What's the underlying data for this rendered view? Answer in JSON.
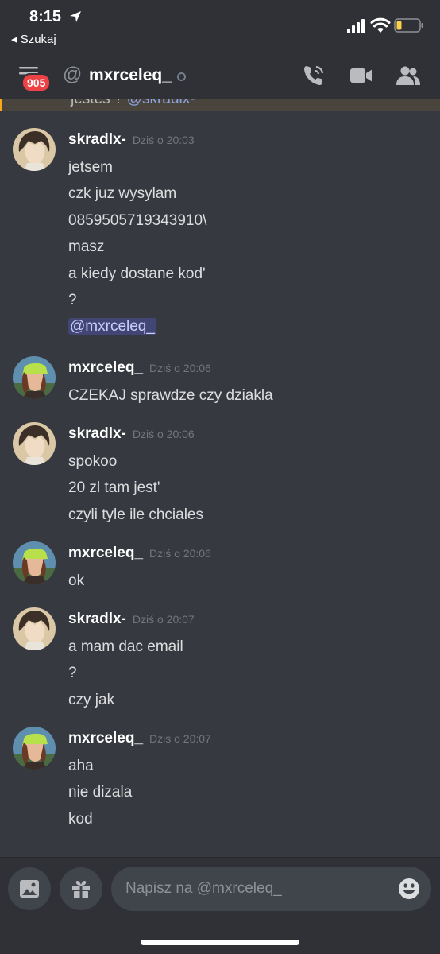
{
  "status_bar": {
    "time": "8:15",
    "back_label": "◂ Szukaj"
  },
  "header": {
    "unread_badge": "905",
    "channel_name": "mxrceleq_"
  },
  "reply_preview": {
    "text": "jesteś ? ",
    "mention": "@skradlx-"
  },
  "messages": [
    {
      "author": "skradlx-",
      "timestamp": "Dziś o 20:03",
      "lines": [
        "jetsem",
        "czk juz wysylam",
        "0859505719343910\\",
        "masz",
        "a kiedy dostane kod'",
        "?"
      ],
      "mention": "@mxrceleq_"
    },
    {
      "author": "mxrceleq_",
      "timestamp": "Dziś o 20:06",
      "lines": [
        "CZEKAJ sprawdze czy dziakla"
      ]
    },
    {
      "author": "skradlx-",
      "timestamp": "Dziś o 20:06",
      "lines": [
        "spokoo",
        "20 zl tam jest'",
        "czyli tyle ile chciales"
      ]
    },
    {
      "author": "mxrceleq_",
      "timestamp": "Dziś o 20:06",
      "lines": [
        "ok"
      ]
    },
    {
      "author": "skradlx-",
      "timestamp": "Dziś o 20:07",
      "lines": [
        "a mam dac email",
        "?",
        "czy jak"
      ]
    },
    {
      "author": "mxrceleq_",
      "timestamp": "Dziś o 20:07",
      "lines": [
        "aha",
        "nie dizala",
        "kod"
      ]
    }
  ],
  "composer": {
    "placeholder": "Napisz na @mxrceleq_"
  },
  "colors": {
    "background": "#36393f",
    "header": "#2f3136",
    "badge": "#ed4245",
    "mention": "#c9cdfb",
    "reply_accent": "#faa61a"
  }
}
